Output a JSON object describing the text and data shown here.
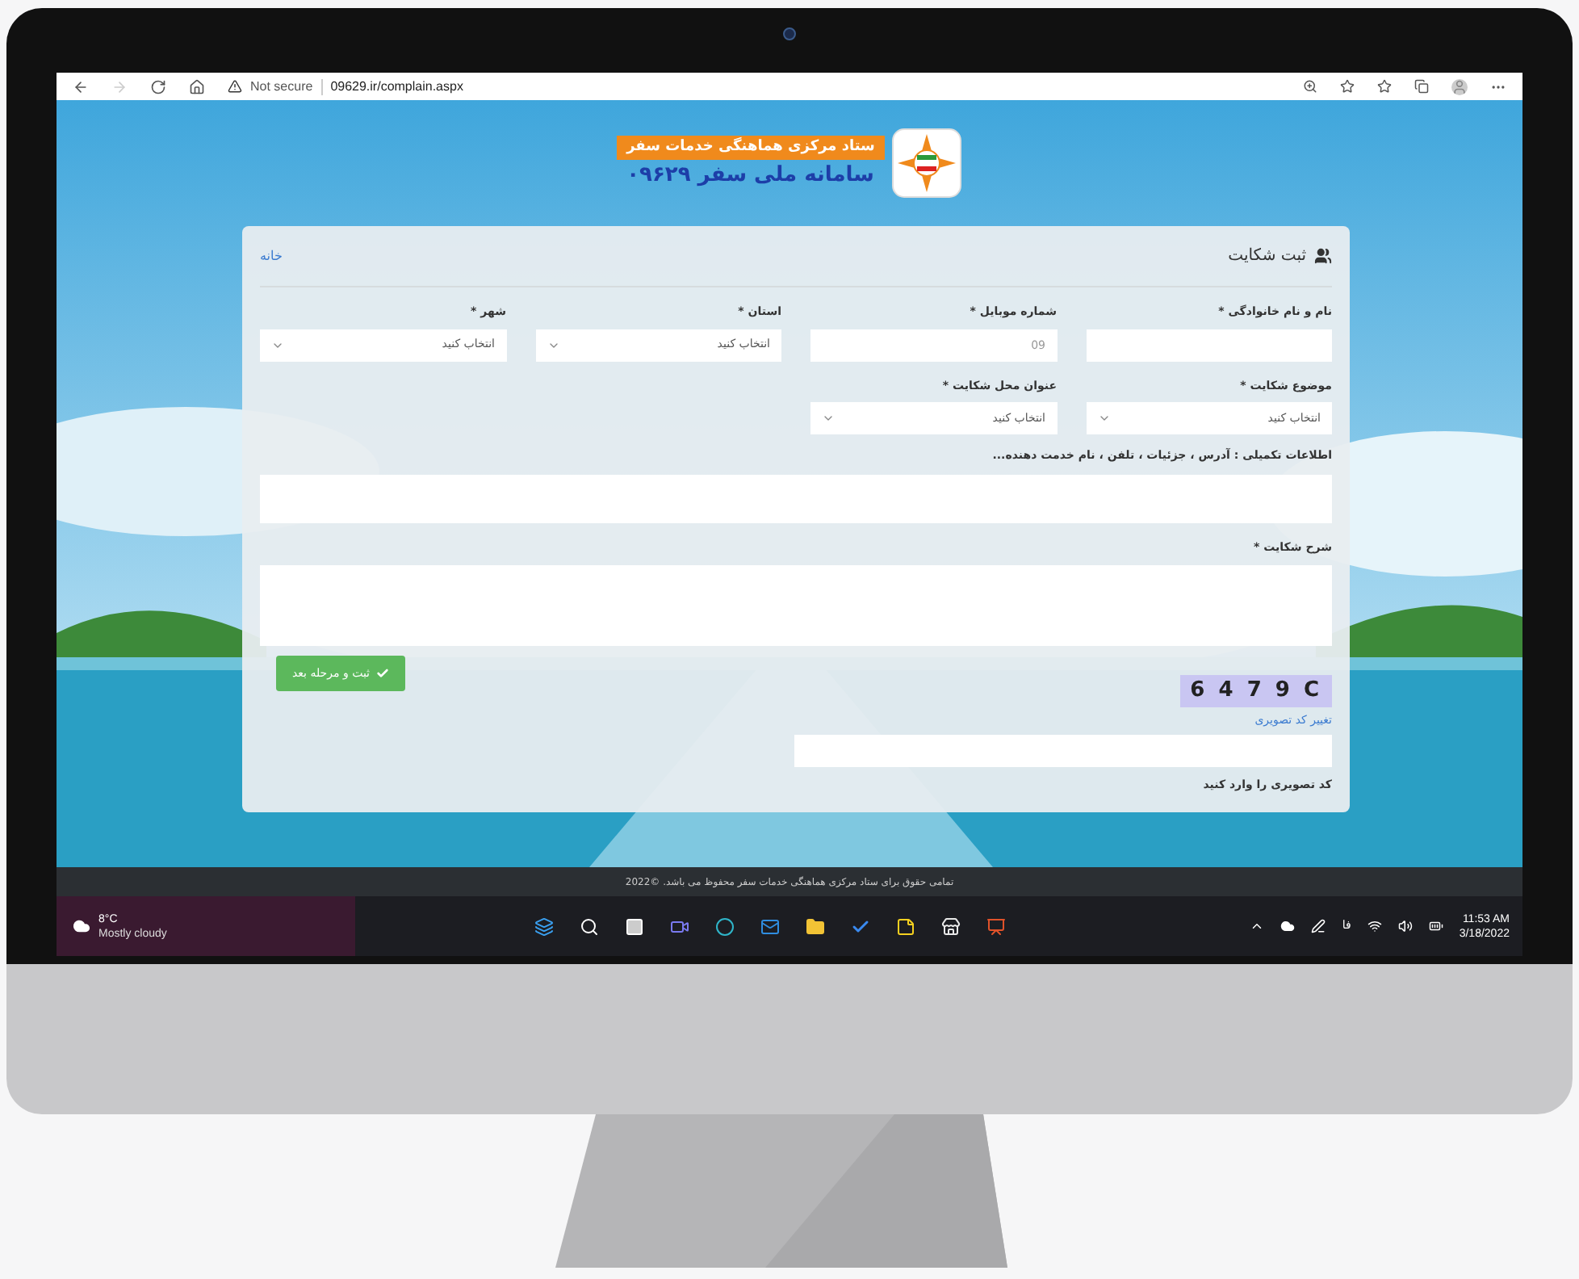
{
  "browser": {
    "security": "Not secure",
    "url": "09629.ir/complain.aspx"
  },
  "banner": {
    "title": "ستاد مرکزی هماهنگی خدمات سفر",
    "subtitle": "سامانه ملی سفر ۰۹۶۲۹"
  },
  "form": {
    "title": "ثبت شکایت",
    "home_link": "خانه",
    "row_1": [
      {
        "kind": "text",
        "label": "نام و نام خانوادگی *"
      },
      {
        "kind": "text",
        "label": "شماره موبایل *",
        "placeholder": "09"
      },
      {
        "kind": "select",
        "label": "استان *",
        "value": "انتخاب کنید"
      },
      {
        "kind": "select",
        "label": "شهر *",
        "value": "انتخاب کنید"
      }
    ],
    "row_2": [
      {
        "kind": "select",
        "label": "موضوع شکایت *",
        "value": "انتخاب کنید"
      },
      {
        "kind": "select",
        "label": "عنوان محل شکایت *",
        "value": "انتخاب کنید"
      }
    ],
    "details_label": "اطلاعات تکمیلی : آدرس ، جزئیات ، تلفن ، نام خدمت دهنده...",
    "description_label": "شرح شکایت *",
    "submit": "ثبت و مرحله بعد",
    "captcha": "6 4 7 9 C",
    "captcha_change": "تغییر کد تصویری",
    "captcha_label": "کد تصویری را وارد کنید"
  },
  "footer": "تمامی حقوق برای ستاد مرکزی هماهنگی خدمات سفر محفوظ می باشد. ©2022",
  "taskbar": {
    "temperature": "8°C",
    "weather": "Mostly cloudy",
    "language": "فا",
    "time": "11:53 AM",
    "date": "3/18/2022"
  }
}
